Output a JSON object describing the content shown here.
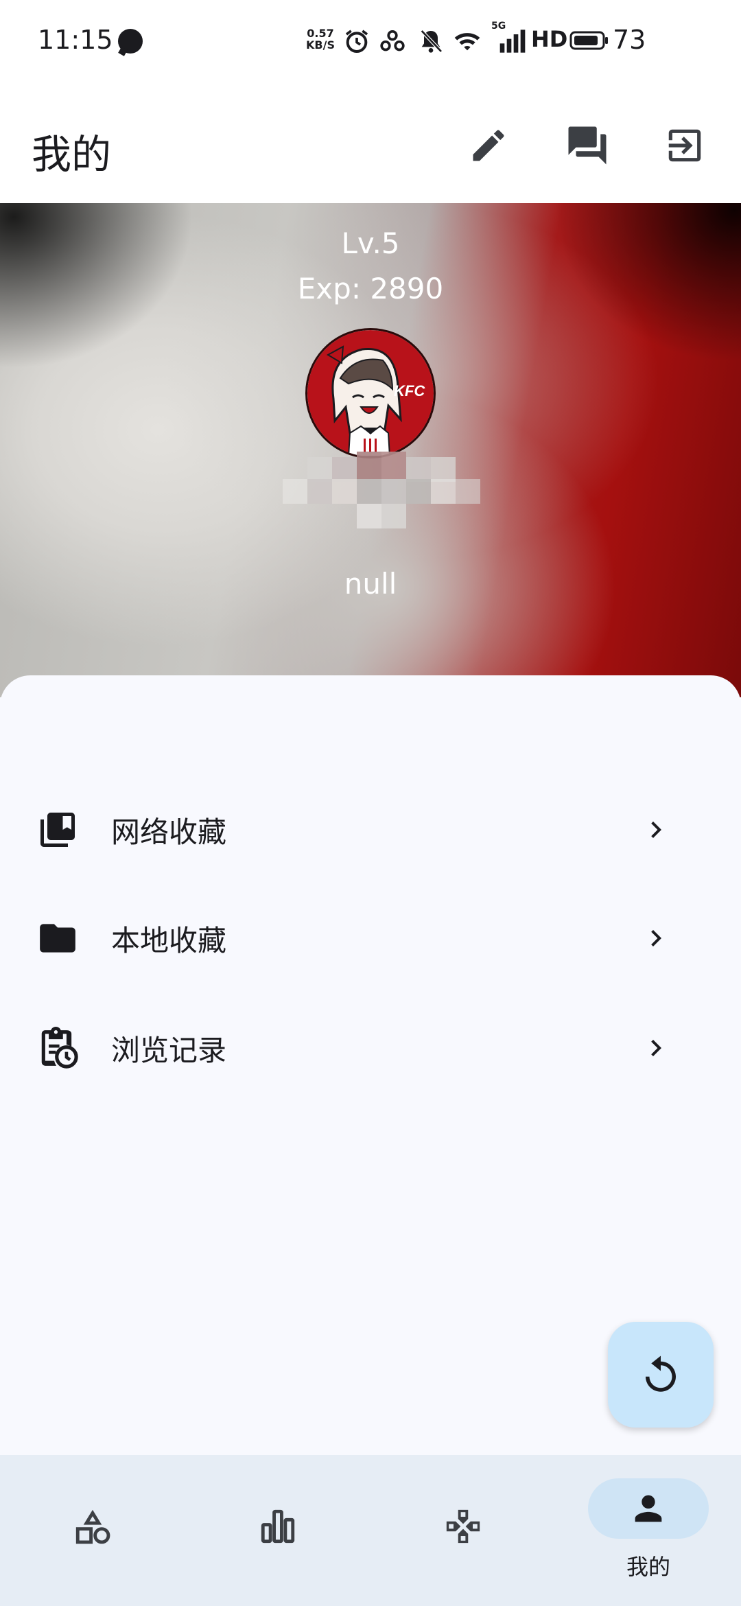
{
  "status_bar": {
    "time": "11:15",
    "net_speed_value": "0.57",
    "net_speed_unit": "KB/S",
    "hd_label": "HD",
    "signal_label": "5G",
    "battery": "73"
  },
  "app_bar": {
    "title": "我的",
    "actions": [
      "edit-icon",
      "forum-icon",
      "logout-icon"
    ]
  },
  "profile": {
    "level": "Lv.5",
    "exp": "Exp: 2890",
    "avatar_text": "KFC",
    "username": "null"
  },
  "menu": {
    "items": [
      {
        "label": "网络收藏",
        "icon": "bookmarks-icon"
      },
      {
        "label": "本地收藏",
        "icon": "folder-icon"
      },
      {
        "label": "浏览记录",
        "icon": "history-clipboard-icon"
      }
    ]
  },
  "fab": {
    "icon": "refresh-icon"
  },
  "bottom_nav": {
    "items": [
      {
        "icon": "category-icon",
        "label": ""
      },
      {
        "icon": "bar-chart-icon",
        "label": ""
      },
      {
        "icon": "gamepad-icon",
        "label": ""
      },
      {
        "icon": "person-icon",
        "label": "我的",
        "active": true
      }
    ]
  },
  "colors": {
    "accent": "#c8e6fb",
    "nav_background": "#e6edf5",
    "header_red": "#a5100f"
  }
}
